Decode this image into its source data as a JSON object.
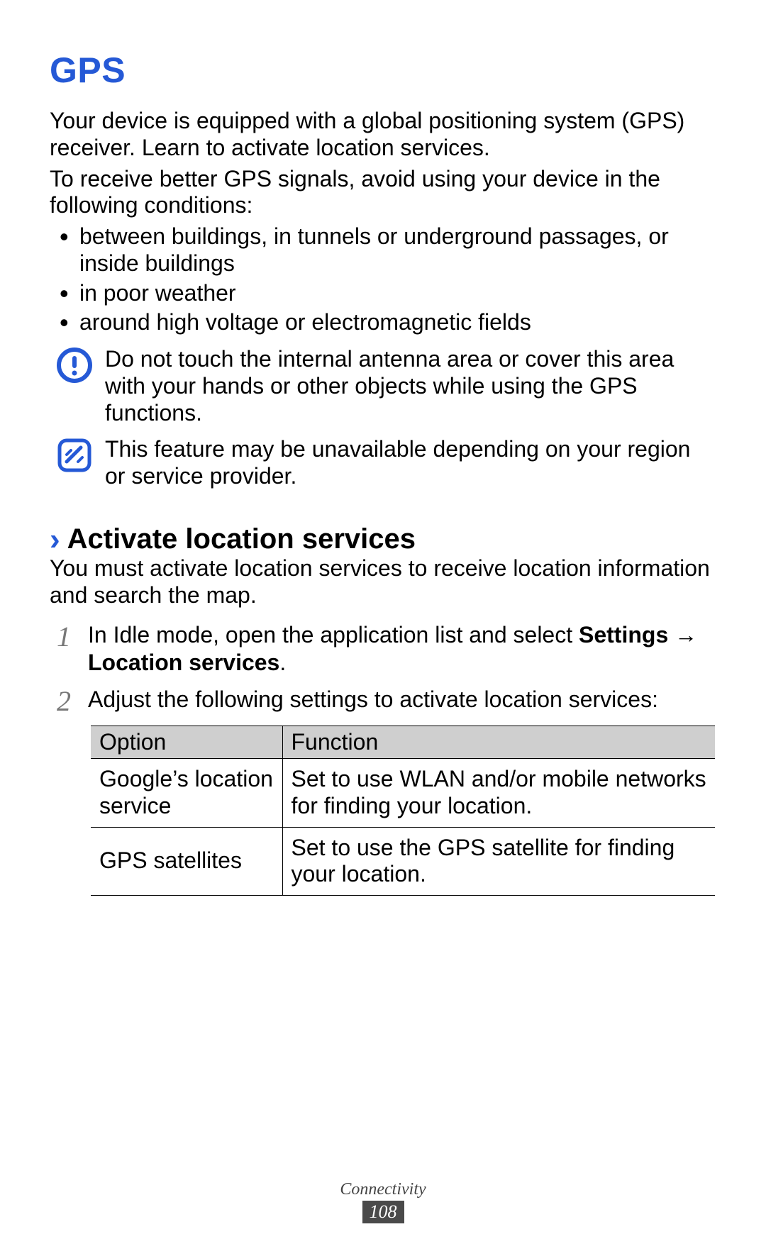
{
  "heading": "GPS",
  "intro1": "Your device is equipped with a global positioning system (GPS) receiver. Learn to activate location services.",
  "intro2": "To receive better GPS signals, avoid using your device in the following conditions:",
  "bullets": {
    "b1": "between buildings, in tunnels or underground passages, or inside buildings",
    "b2": "in poor weather",
    "b3": "around high voltage or electromagnetic fields"
  },
  "callout_warning": "Do not touch the internal antenna area or cover this area with your hands or other objects while using the GPS functions.",
  "callout_note": "This feature may be unavailable depending on your region or service provider.",
  "subheading": "Activate location services",
  "sub_intro": "You must activate location services to receive location information and search the map.",
  "step1_num": "1",
  "step1_pre": "In Idle mode, open the application list and select ",
  "step1_b1": "Settings",
  "step1_arrow": " → ",
  "step1_b2": "Location services",
  "step1_post": ".",
  "step2_num": "2",
  "step2_text": "Adjust the following settings to activate location services:",
  "table": {
    "h1": "Option",
    "h2": "Function",
    "r1c1": "Google’s location service",
    "r1c2": "Set to use WLAN and/or mobile networks for finding your location.",
    "r2c1": "GPS satellites",
    "r2c2": "Set to use the GPS satellite for finding your location."
  },
  "footer_section": "Connectivity",
  "footer_page": "108"
}
